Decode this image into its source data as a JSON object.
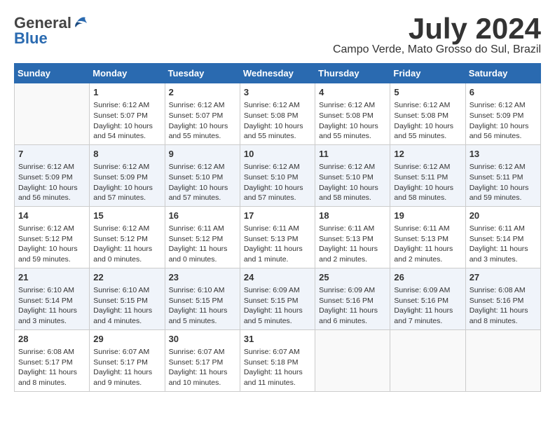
{
  "logo": {
    "general": "General",
    "blue": "Blue"
  },
  "title": {
    "month_year": "July 2024",
    "location": "Campo Verde, Mato Grosso do Sul, Brazil"
  },
  "headers": [
    "Sunday",
    "Monday",
    "Tuesday",
    "Wednesday",
    "Thursday",
    "Friday",
    "Saturday"
  ],
  "weeks": [
    [
      {
        "day": "",
        "sunrise": "",
        "sunset": "",
        "daylight": ""
      },
      {
        "day": "1",
        "sunrise": "Sunrise: 6:12 AM",
        "sunset": "Sunset: 5:07 PM",
        "daylight": "Daylight: 10 hours and 54 minutes."
      },
      {
        "day": "2",
        "sunrise": "Sunrise: 6:12 AM",
        "sunset": "Sunset: 5:07 PM",
        "daylight": "Daylight: 10 hours and 55 minutes."
      },
      {
        "day": "3",
        "sunrise": "Sunrise: 6:12 AM",
        "sunset": "Sunset: 5:08 PM",
        "daylight": "Daylight: 10 hours and 55 minutes."
      },
      {
        "day": "4",
        "sunrise": "Sunrise: 6:12 AM",
        "sunset": "Sunset: 5:08 PM",
        "daylight": "Daylight: 10 hours and 55 minutes."
      },
      {
        "day": "5",
        "sunrise": "Sunrise: 6:12 AM",
        "sunset": "Sunset: 5:08 PM",
        "daylight": "Daylight: 10 hours and 55 minutes."
      },
      {
        "day": "6",
        "sunrise": "Sunrise: 6:12 AM",
        "sunset": "Sunset: 5:09 PM",
        "daylight": "Daylight: 10 hours and 56 minutes."
      }
    ],
    [
      {
        "day": "7",
        "sunrise": "Sunrise: 6:12 AM",
        "sunset": "Sunset: 5:09 PM",
        "daylight": "Daylight: 10 hours and 56 minutes."
      },
      {
        "day": "8",
        "sunrise": "Sunrise: 6:12 AM",
        "sunset": "Sunset: 5:09 PM",
        "daylight": "Daylight: 10 hours and 57 minutes."
      },
      {
        "day": "9",
        "sunrise": "Sunrise: 6:12 AM",
        "sunset": "Sunset: 5:10 PM",
        "daylight": "Daylight: 10 hours and 57 minutes."
      },
      {
        "day": "10",
        "sunrise": "Sunrise: 6:12 AM",
        "sunset": "Sunset: 5:10 PM",
        "daylight": "Daylight: 10 hours and 57 minutes."
      },
      {
        "day": "11",
        "sunrise": "Sunrise: 6:12 AM",
        "sunset": "Sunset: 5:10 PM",
        "daylight": "Daylight: 10 hours and 58 minutes."
      },
      {
        "day": "12",
        "sunrise": "Sunrise: 6:12 AM",
        "sunset": "Sunset: 5:11 PM",
        "daylight": "Daylight: 10 hours and 58 minutes."
      },
      {
        "day": "13",
        "sunrise": "Sunrise: 6:12 AM",
        "sunset": "Sunset: 5:11 PM",
        "daylight": "Daylight: 10 hours and 59 minutes."
      }
    ],
    [
      {
        "day": "14",
        "sunrise": "Sunrise: 6:12 AM",
        "sunset": "Sunset: 5:12 PM",
        "daylight": "Daylight: 10 hours and 59 minutes."
      },
      {
        "day": "15",
        "sunrise": "Sunrise: 6:12 AM",
        "sunset": "Sunset: 5:12 PM",
        "daylight": "Daylight: 11 hours and 0 minutes."
      },
      {
        "day": "16",
        "sunrise": "Sunrise: 6:11 AM",
        "sunset": "Sunset: 5:12 PM",
        "daylight": "Daylight: 11 hours and 0 minutes."
      },
      {
        "day": "17",
        "sunrise": "Sunrise: 6:11 AM",
        "sunset": "Sunset: 5:13 PM",
        "daylight": "Daylight: 11 hours and 1 minute."
      },
      {
        "day": "18",
        "sunrise": "Sunrise: 6:11 AM",
        "sunset": "Sunset: 5:13 PM",
        "daylight": "Daylight: 11 hours and 2 minutes."
      },
      {
        "day": "19",
        "sunrise": "Sunrise: 6:11 AM",
        "sunset": "Sunset: 5:13 PM",
        "daylight": "Daylight: 11 hours and 2 minutes."
      },
      {
        "day": "20",
        "sunrise": "Sunrise: 6:11 AM",
        "sunset": "Sunset: 5:14 PM",
        "daylight": "Daylight: 11 hours and 3 minutes."
      }
    ],
    [
      {
        "day": "21",
        "sunrise": "Sunrise: 6:10 AM",
        "sunset": "Sunset: 5:14 PM",
        "daylight": "Daylight: 11 hours and 3 minutes."
      },
      {
        "day": "22",
        "sunrise": "Sunrise: 6:10 AM",
        "sunset": "Sunset: 5:15 PM",
        "daylight": "Daylight: 11 hours and 4 minutes."
      },
      {
        "day": "23",
        "sunrise": "Sunrise: 6:10 AM",
        "sunset": "Sunset: 5:15 PM",
        "daylight": "Daylight: 11 hours and 5 minutes."
      },
      {
        "day": "24",
        "sunrise": "Sunrise: 6:09 AM",
        "sunset": "Sunset: 5:15 PM",
        "daylight": "Daylight: 11 hours and 5 minutes."
      },
      {
        "day": "25",
        "sunrise": "Sunrise: 6:09 AM",
        "sunset": "Sunset: 5:16 PM",
        "daylight": "Daylight: 11 hours and 6 minutes."
      },
      {
        "day": "26",
        "sunrise": "Sunrise: 6:09 AM",
        "sunset": "Sunset: 5:16 PM",
        "daylight": "Daylight: 11 hours and 7 minutes."
      },
      {
        "day": "27",
        "sunrise": "Sunrise: 6:08 AM",
        "sunset": "Sunset: 5:16 PM",
        "daylight": "Daylight: 11 hours and 8 minutes."
      }
    ],
    [
      {
        "day": "28",
        "sunrise": "Sunrise: 6:08 AM",
        "sunset": "Sunset: 5:17 PM",
        "daylight": "Daylight: 11 hours and 8 minutes."
      },
      {
        "day": "29",
        "sunrise": "Sunrise: 6:07 AM",
        "sunset": "Sunset: 5:17 PM",
        "daylight": "Daylight: 11 hours and 9 minutes."
      },
      {
        "day": "30",
        "sunrise": "Sunrise: 6:07 AM",
        "sunset": "Sunset: 5:17 PM",
        "daylight": "Daylight: 11 hours and 10 minutes."
      },
      {
        "day": "31",
        "sunrise": "Sunrise: 6:07 AM",
        "sunset": "Sunset: 5:18 PM",
        "daylight": "Daylight: 11 hours and 11 minutes."
      },
      {
        "day": "",
        "sunrise": "",
        "sunset": "",
        "daylight": ""
      },
      {
        "day": "",
        "sunrise": "",
        "sunset": "",
        "daylight": ""
      },
      {
        "day": "",
        "sunrise": "",
        "sunset": "",
        "daylight": ""
      }
    ]
  ]
}
